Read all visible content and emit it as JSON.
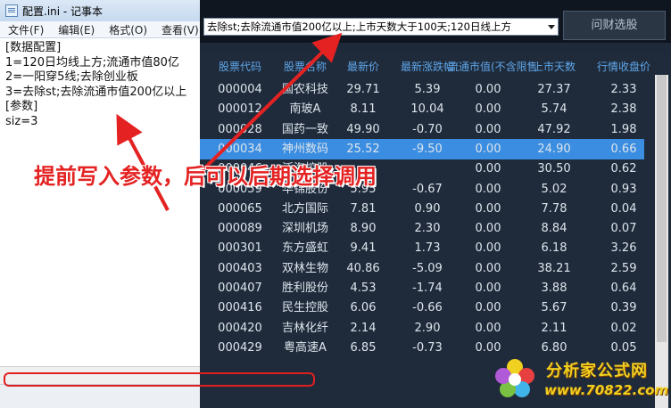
{
  "notepad": {
    "title": "配置.ini - 记事本",
    "menu": [
      "文件(F)",
      "编辑(E)",
      "格式(O)",
      "查看(V)"
    ],
    "lines": [
      "[数据配置]",
      "1=120日均线上方;流通市值80亿",
      "2=一阳穿5线;去除创业板",
      "3=去除st;去除流通市值200亿以上",
      "[参数]",
      "siz=3"
    ]
  },
  "query": {
    "combo_value": "去除st;去除流通市值200亿以上;上市天数大于100天;120日线上方",
    "button_label": "问财选股"
  },
  "table": {
    "columns": [
      "股票代码",
      "股票名称",
      "最新价",
      "最新涨跌幅",
      "流通市值(不含限售",
      "上市天数",
      "行情收盘价"
    ],
    "rows": [
      [
        "000004",
        "国农科技",
        "29.71",
        "5.39",
        "0.00",
        "27.37",
        "2.33"
      ],
      [
        "000012",
        "南玻A",
        "8.11",
        "10.04",
        "0.00",
        "5.74",
        "2.38"
      ],
      [
        "000028",
        "国药一致",
        "49.90",
        "-0.70",
        "0.00",
        "47.92",
        "1.98"
      ],
      [
        "000034",
        "神州数码",
        "25.52",
        "-9.50",
        "0.00",
        "24.90",
        "0.66"
      ],
      [
        "000046",
        "泛海控股",
        "",
        "",
        "0.00",
        "30.50",
        "0.62"
      ],
      [
        "000059",
        "华锦股份",
        "5.95",
        "-0.67",
        "0.00",
        "5.02",
        "0.93"
      ],
      [
        "000065",
        "北方国际",
        "7.81",
        "0.90",
        "0.00",
        "7.78",
        "0.04"
      ],
      [
        "000089",
        "深圳机场",
        "8.90",
        "2.30",
        "0.00",
        "8.84",
        "0.07"
      ],
      [
        "000301",
        "东方盛虹",
        "9.41",
        "1.73",
        "0.00",
        "6.18",
        "3.26"
      ],
      [
        "000403",
        "双林生物",
        "40.86",
        "-5.09",
        "0.00",
        "38.21",
        "2.59"
      ],
      [
        "000407",
        "胜利股份",
        "4.53",
        "-1.74",
        "0.00",
        "3.88",
        "0.64"
      ],
      [
        "000416",
        "民生控股",
        "6.06",
        "-0.66",
        "0.00",
        "5.67",
        "0.39"
      ],
      [
        "000420",
        "吉林化纤",
        "2.14",
        "2.90",
        "0.00",
        "2.11",
        "0.02"
      ],
      [
        "000429",
        "粤高速A",
        "6.85",
        "-0.73",
        "0.00",
        "6.80",
        "0.05"
      ]
    ],
    "selected_index": 3
  },
  "annotation": "提前写入参数，后可以后期选择调用",
  "watermark": {
    "title": "分析家公式网",
    "url": "www.70822.com"
  }
}
